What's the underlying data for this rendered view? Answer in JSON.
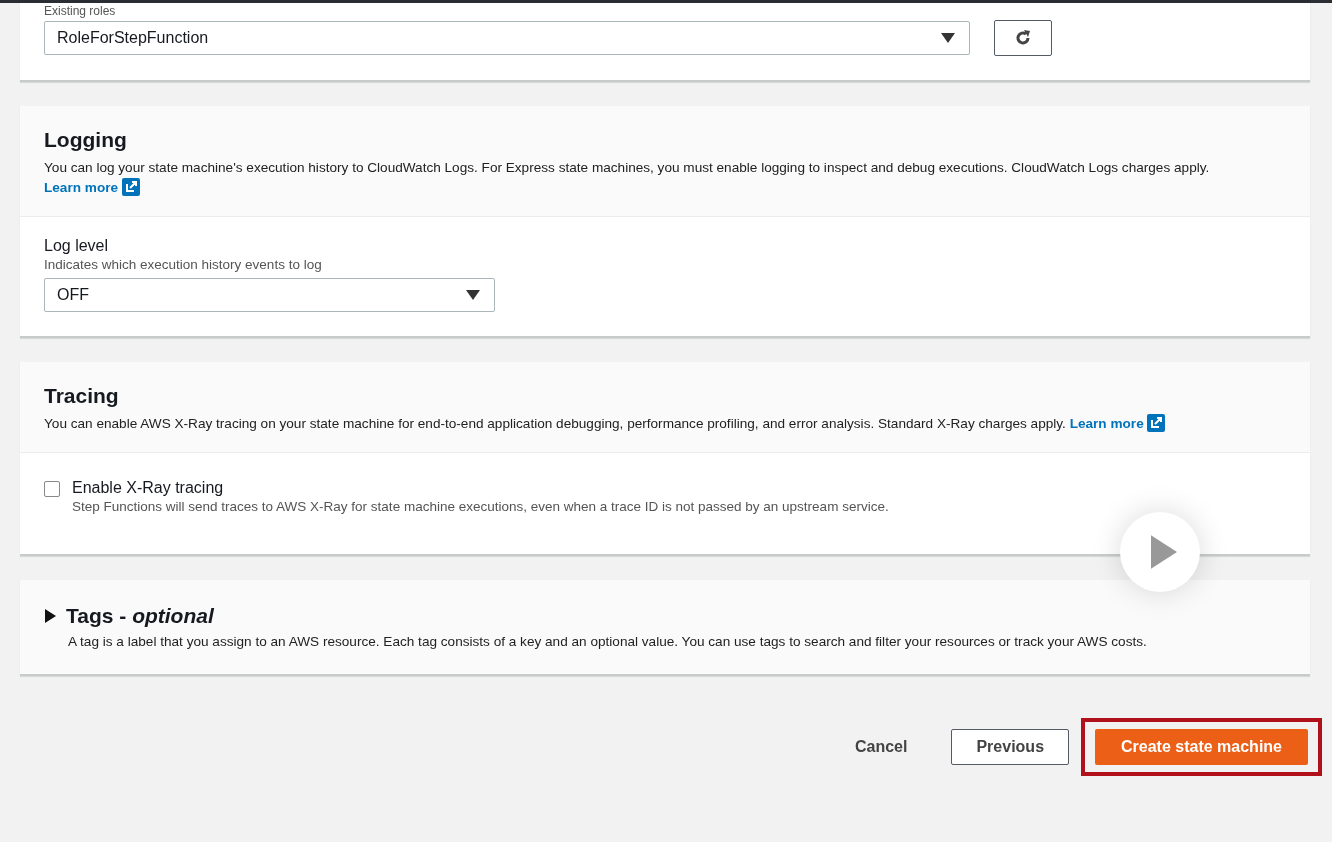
{
  "role_panel": {
    "label": "Existing roles",
    "value": "RoleForStepFunction"
  },
  "logging": {
    "title": "Logging",
    "description": "You can log your state machine's execution history to CloudWatch Logs. For Express state machines, you must enable logging to inspect and debug executions. CloudWatch Logs charges apply.",
    "link": "Learn more",
    "field_label": "Log level",
    "field_hint": "Indicates which execution history events to log",
    "value": "OFF"
  },
  "tracing": {
    "title": "Tracing",
    "description": "You can enable AWS X-Ray tracing on your state machine for end-to-end application debugging, performance profiling, and error analysis. Standard X-Ray charges apply.",
    "link": "Learn more",
    "checkbox": {
      "label": "Enable X-Ray tracing",
      "hint": "Step Functions will send traces to AWS X-Ray for state machine executions, even when a trace ID is not passed by an upstream service.",
      "checked": false
    }
  },
  "tags": {
    "title": "Tags - *optional*",
    "expanded": false,
    "description": "A tag is a label that you assign to an AWS resource. Each tag consists of a key and an optional value. You can use tags to search and filter your resources or track your AWS costs."
  },
  "buttons": [
    {
      "label": "Cancel",
      "kind": "link"
    },
    {
      "label": "Previous",
      "kind": "secondary"
    },
    {
      "label": "Create state machine",
      "kind": "primary"
    }
  ]
}
